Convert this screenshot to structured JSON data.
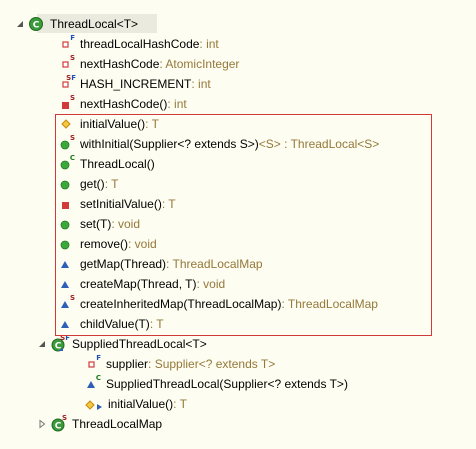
{
  "outline": {
    "root": {
      "label": "ThreadLocal<T>",
      "expanded": true
    },
    "members": [
      {
        "name": "threadLocalHashCode",
        "type": " : int"
      },
      {
        "name": "nextHashCode",
        "type": " : AtomicInteger"
      },
      {
        "name": "HASH_INCREMENT",
        "type": " : int"
      },
      {
        "name": "nextHashCode()",
        "type": " : int"
      },
      {
        "name": "initialValue()",
        "type": " : T"
      },
      {
        "name": "withInitial(Supplier<? extends S>)",
        "type": " <S> : ThreadLocal<S>"
      },
      {
        "name": "ThreadLocal()",
        "type": ""
      },
      {
        "name": "get()",
        "type": " : T"
      },
      {
        "name": "setInitialValue()",
        "type": " : T"
      },
      {
        "name": "set(T)",
        "type": " : void"
      },
      {
        "name": "remove()",
        "type": " : void"
      },
      {
        "name": "getMap(Thread)",
        "type": " : ThreadLocalMap"
      },
      {
        "name": "createMap(Thread, T)",
        "type": " : void"
      },
      {
        "name": "createInheritedMap(ThreadLocalMap)",
        "type": " : ThreadLocalMap"
      },
      {
        "name": "childValue(T)",
        "type": " : T"
      }
    ],
    "supplied": {
      "label": "SuppliedThreadLocal<T>",
      "members": [
        {
          "name": "supplier",
          "type": " : Supplier<? extends T>"
        },
        {
          "name": "SuppliedThreadLocal(Supplier<? extends T>)",
          "type": ""
        },
        {
          "name": "initialValue()",
          "type": " : T"
        }
      ]
    },
    "map": {
      "label": "ThreadLocalMap",
      "expanded": false
    }
  },
  "colors": {
    "background": "#fdfdf1",
    "return_type": "#95783a",
    "highlight_border": "#d23a3a",
    "public_method": "#3aa83a",
    "private_member": "#d23a3a",
    "package_member": "#2e5fb8",
    "protected_member": "#e8a318"
  }
}
